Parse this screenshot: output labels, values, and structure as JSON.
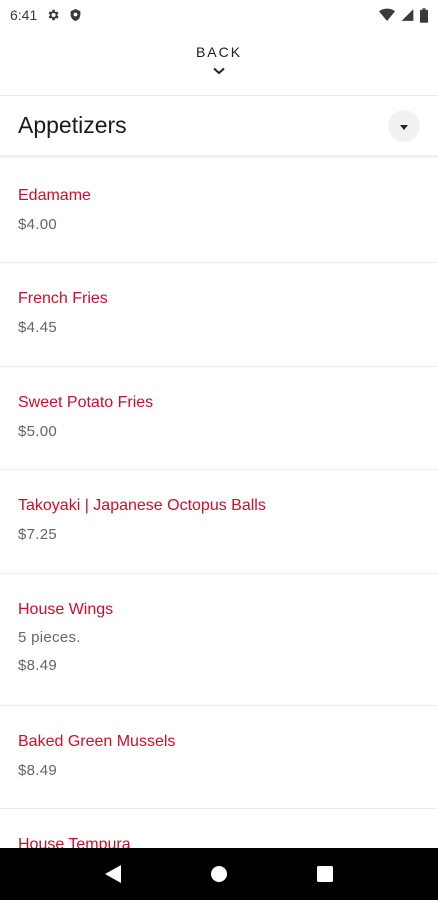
{
  "status_bar": {
    "time": "6:41",
    "icons": [
      "gear-icon",
      "shield-icon",
      "wifi-icon",
      "signal-icon",
      "battery-icon"
    ]
  },
  "header": {
    "back_label": "BACK"
  },
  "category": {
    "title": "Appetizers"
  },
  "colors": {
    "item_name": "#c8102e",
    "price": "#666666",
    "nav_bar": "#000000"
  },
  "menu_items": [
    {
      "name": "Edamame",
      "price": "$4.00"
    },
    {
      "name": "French Fries",
      "price": "$4.45"
    },
    {
      "name": "Sweet Potato Fries",
      "price": "$5.00"
    },
    {
      "name": "Takoyaki | Japanese Octopus Balls",
      "price": "$7.25"
    },
    {
      "name": "House Wings",
      "description": "5 pieces.",
      "price": "$8.49"
    },
    {
      "name": "Baked Green Mussels",
      "price": "$8.49"
    },
    {
      "name": "House Tempura",
      "price": ""
    }
  ],
  "nav_bar": {
    "icons": [
      "back-triangle-icon",
      "home-circle-icon",
      "recents-square-icon"
    ]
  }
}
